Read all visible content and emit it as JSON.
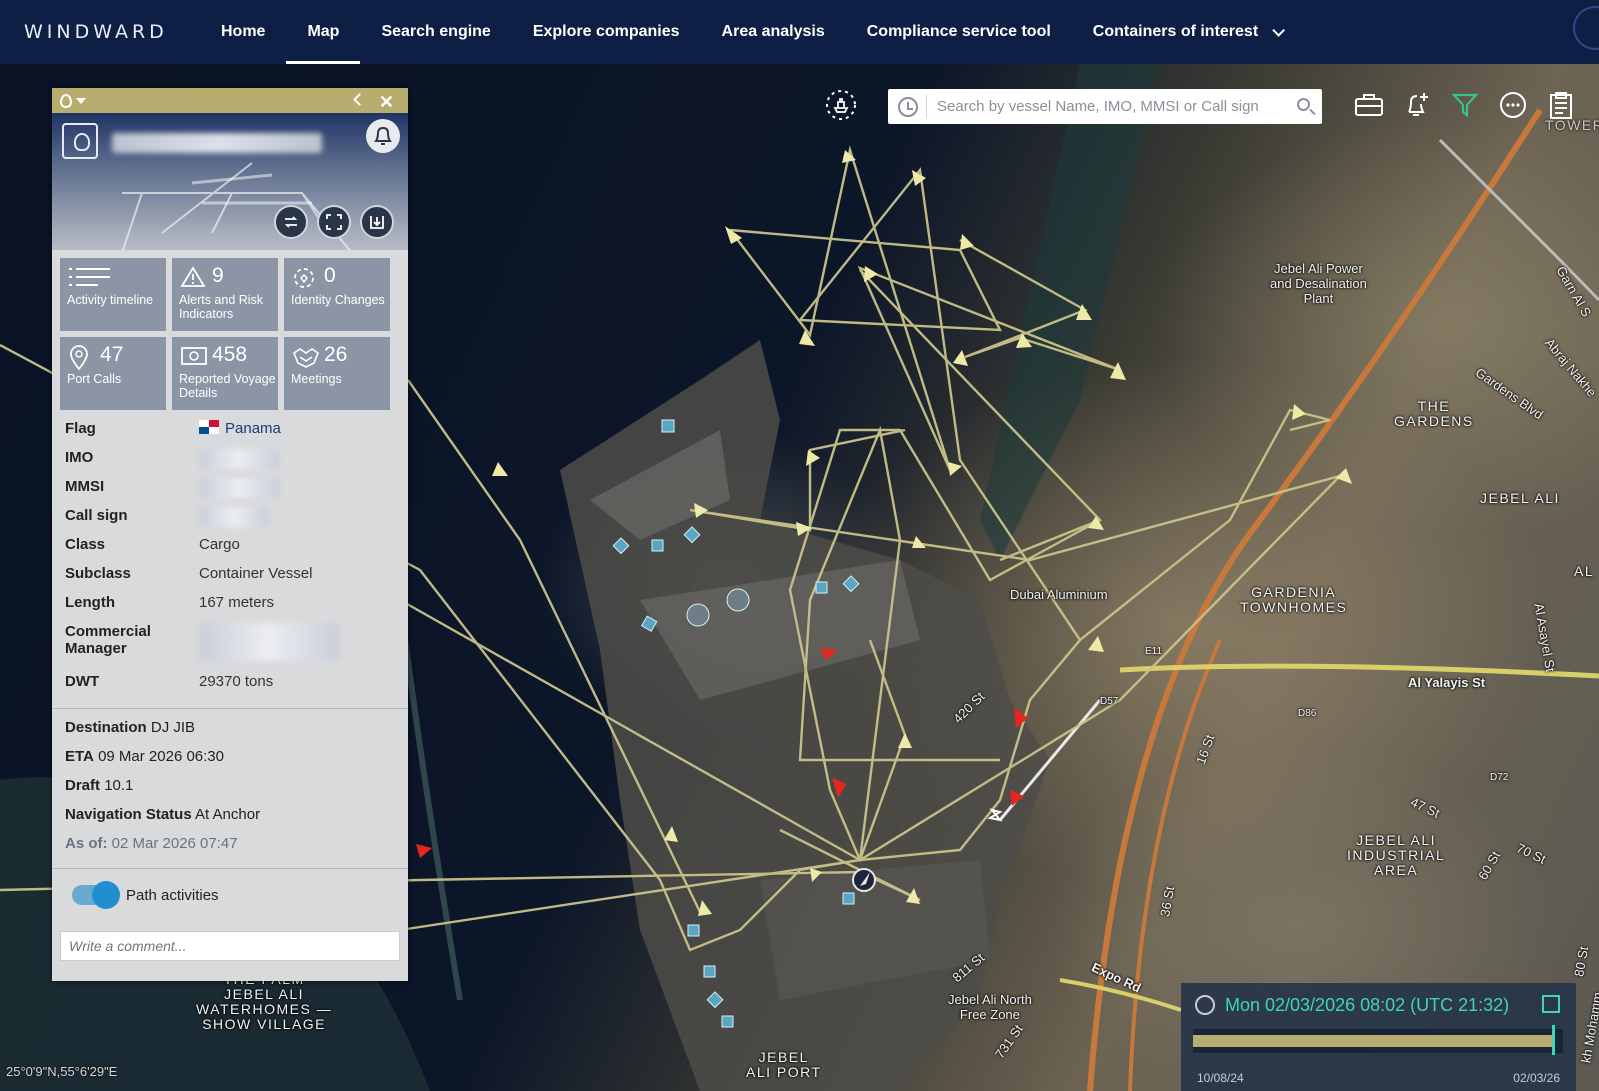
{
  "nav": {
    "brand": "WINDWARD",
    "items": [
      {
        "label": "Home",
        "active": false
      },
      {
        "label": "Map",
        "active": true
      },
      {
        "label": "Search engine",
        "active": false
      },
      {
        "label": "Explore companies",
        "active": false
      },
      {
        "label": "Area analysis",
        "active": false
      },
      {
        "label": "Compliance service tool",
        "active": false
      },
      {
        "label": "Containers of interest",
        "active": false
      }
    ]
  },
  "search": {
    "placeholder": "Search by vessel Name, IMO, MMSI or Call sign"
  },
  "toolbar": {
    "icons": [
      "ship-lock-icon",
      "briefcase-icon",
      "bell-plus-icon",
      "filter-icon",
      "more-icon",
      "clipboard-icon"
    ],
    "accent_filter": "#35c48a"
  },
  "panel": {
    "tiles": [
      {
        "icon": "list-icon",
        "count": "",
        "label": "Activity timeline"
      },
      {
        "icon": "warning-icon",
        "count": "9",
        "label": "Alerts and Risk Indicators"
      },
      {
        "icon": "identity-icon",
        "count": "0",
        "label": "Identity Changes"
      },
      {
        "icon": "pin-icon",
        "count": "47",
        "label": "Port Calls"
      },
      {
        "icon": "voyage-icon",
        "count": "458",
        "label": "Reported Voyage Details"
      },
      {
        "icon": "handshake-icon",
        "count": "26",
        "label": "Meetings"
      }
    ],
    "details": {
      "flag_label": "Flag",
      "flag_value": "Panama",
      "imo_label": "IMO",
      "mmsi_label": "MMSI",
      "callsign_label": "Call sign",
      "class_label": "Class",
      "class_value": "Cargo",
      "subclass_label": "Subclass",
      "subclass_value": "Container Vessel",
      "length_label": "Length",
      "length_value": "167 meters",
      "manager_label": "Commercial Manager",
      "dwt_label": "DWT",
      "dwt_value": "29370 tons"
    },
    "status": {
      "destination_label": "Destination",
      "destination_value": "DJ JIB",
      "eta_label": "ETA",
      "eta_value": "09 Mar 2026 06:30",
      "draft_label": "Draft",
      "draft_value": "10.1",
      "navstatus_label": "Navigation Status",
      "navstatus_value": "At Anchor",
      "asof_label": "As of:",
      "asof_value": "02 Mar 2026 07:47"
    },
    "path_label": "Path activities",
    "path_on": true,
    "comment_placeholder": "Write a comment..."
  },
  "map": {
    "labels": {
      "jebel_ali_power": "Jebel Ali Power\nand Desalination\nPlant",
      "the_gardens": "THE\nGARDENS",
      "jebel_ali": "JEBEL ALI",
      "gardenia": "GARDENIA\nTOWNHOMES",
      "dubai_aluminium": "Dubai Aluminium",
      "al_yalayis": "Al Yalayis St",
      "jebel_ali_industrial": "JEBEL ALI\nINDUSTRIAL\nAREA",
      "jebel_ali_port": "JEBEL\nALI PORT",
      "jebel_ali_north": "Jebel Ali North\nFree Zone",
      "the_palm": "THE PALM\nJEBEL ALI\nWATERHOMES —\nSHOW VILLAGE",
      "st_420": "420 St",
      "expo_rd": "Expo Rd",
      "st_811": "811 St",
      "gardens_blvd": "Gardens Blvd",
      "abraj_nakheel": "Abraj Nakhe",
      "st_47": "47 St",
      "st_70": "70 St",
      "st_60": "60 St",
      "st_16": "16 St",
      "st_36": "36 St",
      "st_731": "731 St",
      "garn_al": "Garn Al S",
      "al_asayel": "Al Asayel St",
      "e11": "E11",
      "d57": "D57",
      "d86": "D86",
      "d72": "D72",
      "tower": "TOWER",
      "al": "AL",
      "khmohamm": "kh Mohamm",
      "st_80": "80 St"
    },
    "coordinates": "25°0'9\"N,55°6'29\"E"
  },
  "timeline": {
    "current": "Mon 02/03/2026 08:02 (UTC 21:32)",
    "start": "10/08/24",
    "end": "02/03/26",
    "progress": 0.97,
    "track_color": "#b6ad6e",
    "accent": "#40d4b8"
  }
}
